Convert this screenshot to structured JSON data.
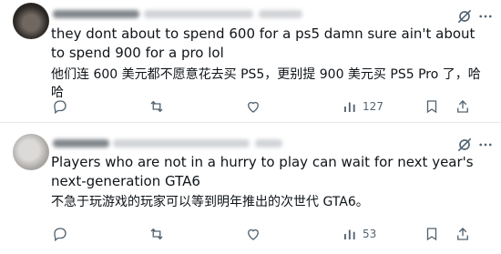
{
  "posts": [
    {
      "text": "they dont about to spend 600 for a ps5 damn sure ain't about to spend 900 for a pro lol",
      "translation": "他们连 600 美元都不愿意花去买 PS5，更别提 900 美元买 PS5 Pro 了，哈哈",
      "views": "127"
    },
    {
      "text": "Players who are not in a hurry to play can wait for next year's next-generation GTA6",
      "translation": "不急于玩游戏的玩家可以等到明年推出的次世代 GTA6。",
      "views": "53"
    }
  ],
  "icons": {
    "reply": "reply-icon",
    "repost": "repost-icon",
    "like": "like-icon",
    "views": "views-icon",
    "bookmark": "bookmark-icon",
    "share": "share-icon",
    "grok": "grok-icon",
    "more": "more-icon"
  },
  "colors": {
    "text": "#0f1419",
    "muted": "#536471",
    "divider": "#e6e9ec"
  }
}
